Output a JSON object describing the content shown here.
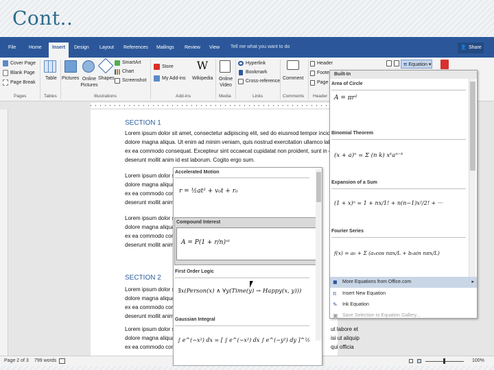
{
  "slide": {
    "title": "Cont.."
  },
  "tabs": [
    "File",
    "Home",
    "Insert",
    "Design",
    "Layout",
    "References",
    "Mailings",
    "Review",
    "View"
  ],
  "tell_me": "Tell me what you want to do",
  "user": "Share",
  "ribbon": {
    "pages": {
      "cover_page": "Cover Page",
      "blank_page": "Blank Page",
      "page_break": "Page Break",
      "group": "Pages"
    },
    "tables": {
      "table": "Table",
      "group": "Tables"
    },
    "illustrations": {
      "pictures": "Pictures",
      "online_pictures": "Online Pictures",
      "shapes": "Shapes",
      "smartart": "SmartArt",
      "chart": "Chart",
      "screenshot": "Screenshot",
      "group": "Illustrations"
    },
    "addins": {
      "store": "Store",
      "my_addins": "My Add-ins",
      "wikipedia": "Wikipedia",
      "group": "Add-ins"
    },
    "media": {
      "online_video": "Online Video",
      "group": "Media"
    },
    "links": {
      "hyperlink": "Hyperlink",
      "bookmark": "Bookmark",
      "cross_reference": "Cross-reference",
      "group": "Links"
    },
    "comments": {
      "comment": "Comment",
      "group": "Comments"
    },
    "header_footer": {
      "header": "Header",
      "footer": "Foote",
      "page": "Page",
      "group": "Header"
    },
    "symbols": {
      "equation": "Equation"
    }
  },
  "document": {
    "section1": "SECTION 1",
    "section2": "SECTION 2",
    "p1": [
      "Lorem ipsum dolor sit amet, consectetur adipiscing elit, sed do eiusmod tempor incididu",
      "dolore magna aliqua. Ut enim ad minim veniam, quis nostrud exercitation ullamco laboris",
      "ex ea commodo consequat. Excepteur sint occaecat cupidatat non proident, sunt in culpa",
      "deserunt mollit anim id est laborum. Cogito ergo sum."
    ],
    "p_left": [
      "Lorem ipsum dolor sit",
      "dolore magna aliqua.",
      "ex ea commodo consec",
      "deserunt mollit anim id"
    ],
    "p_right2": [
      "ut labore et",
      "isi ut aliquip",
      "qui officia"
    ]
  },
  "status": {
    "page": "Page 2 of 3",
    "words": "799 words",
    "zoom": "100%"
  },
  "eq_panel": {
    "header": "Built-In",
    "items": [
      {
        "label": "Area of Circle",
        "eq": "A = πr²"
      },
      {
        "label": "Binomial Theorem",
        "eq": "(x + a)ⁿ = Σ (n k) xᵏaⁿ⁻ᵏ"
      },
      {
        "label": "Expansion of a Sum",
        "eq": "(1 + x)ⁿ = 1 + nx/1! + n(n−1)x²/2! + ···"
      },
      {
        "label": "Fourier Series",
        "eq": "f(x) = a₀ + Σ (aₙcos nπx/L + bₙsin nπx/L)"
      }
    ],
    "menu": [
      "More Equations from Office.com",
      "Insert New Equation",
      "Ink Equation",
      "Save Selection to Equation Gallery..."
    ]
  },
  "left_gallery": {
    "items": [
      {
        "label": "Accelerated Motion",
        "eq": "r = ½at² + v₀t + r₀"
      },
      {
        "label": "Compound Interest",
        "eq": "A = P(1 + r/n)ⁿᵗ"
      },
      {
        "label": "First Order Logic",
        "eq": "∃x(Person(x) ∧ ∀y(Time(y) → Happy(x, y)))"
      },
      {
        "label": "Gaussian Integral",
        "eq": "∫ e^(−x²) dx = [ ∫ e^(−x²) dx ∫ e^(−y²) dy ]^½"
      }
    ]
  }
}
